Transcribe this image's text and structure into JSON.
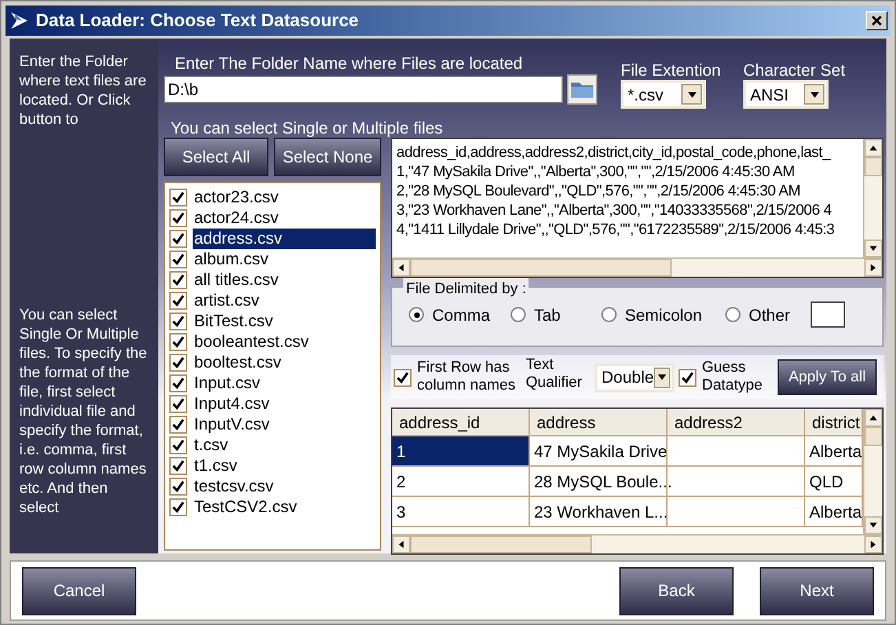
{
  "window": {
    "title": "Data Loader: Choose Text Datasource"
  },
  "sidebar": {
    "top_text": "Enter the Folder where text files are located. Or Click button to",
    "bottom_text": "You can select Single Or Multiple files. To specify the the format of the file, first select individual file and specify the format, i.e. comma, first row column names etc. And then select"
  },
  "folder": {
    "label": "Enter The Folder Name where Files are located",
    "value": "D:\\b"
  },
  "file_extension": {
    "label": "File Extention",
    "value": "*.csv"
  },
  "character_set": {
    "label": "Character Set",
    "value": "ANSI"
  },
  "files_label": "You can select Single or Multiple files",
  "select_buttons": [
    "Select All",
    "Select None"
  ],
  "files": [
    {
      "name": "actor23.csv",
      "checked": true,
      "selected": false
    },
    {
      "name": "actor24.csv",
      "checked": true,
      "selected": false
    },
    {
      "name": "address.csv",
      "checked": true,
      "selected": true
    },
    {
      "name": "album.csv",
      "checked": true,
      "selected": false
    },
    {
      "name": "all titles.csv",
      "checked": true,
      "selected": false
    },
    {
      "name": "artist.csv",
      "checked": true,
      "selected": false
    },
    {
      "name": "BitTest.csv",
      "checked": true,
      "selected": false
    },
    {
      "name": "booleantest.csv",
      "checked": true,
      "selected": false
    },
    {
      "name": "booltest.csv",
      "checked": true,
      "selected": false
    },
    {
      "name": "Input.csv",
      "checked": true,
      "selected": false
    },
    {
      "name": "Input4.csv",
      "checked": true,
      "selected": false
    },
    {
      "name": "InputV.csv",
      "checked": true,
      "selected": false
    },
    {
      "name": "t.csv",
      "checked": true,
      "selected": false
    },
    {
      "name": "t1.csv",
      "checked": true,
      "selected": false
    },
    {
      "name": "testcsv.csv",
      "checked": true,
      "selected": false
    },
    {
      "name": "TestCSV2.csv",
      "checked": true,
      "selected": false
    }
  ],
  "preview_lines": [
    "address_id,address,address2,district,city_id,postal_code,phone,last_",
    "1,\"47 MySakila Drive\",,\"Alberta\",300,\"\",\"\",2/15/2006 4:45:30 AM",
    "2,\"28 MySQL Boulevard\",,\"QLD\",576,\"\",\"\",2/15/2006 4:45:30 AM",
    "3,\"23 Workhaven Lane\",,\"Alberta\",300,\"\",\"14033335568\",2/15/2006 4",
    "4,\"1411 Lillydale Drive\",,\"QLD\",576,\"\",\"6172235589\",2/15/2006 4:45:3"
  ],
  "delimiter": {
    "title": "File Delimited by :",
    "options": [
      {
        "label": "Comma",
        "selected": true
      },
      {
        "label": "Tab",
        "selected": false
      },
      {
        "label": "Semicolon",
        "selected": false
      },
      {
        "label": "Other",
        "selected": false
      }
    ]
  },
  "first_row_header": {
    "label": "First Row has column names",
    "checked": true
  },
  "text_qualifier": {
    "label": "Text Qualifier",
    "value": "Double"
  },
  "guess_datatype": {
    "label": "Guess Datatype",
    "checked": true
  },
  "apply_button": "Apply To all",
  "grid": {
    "columns": [
      "address_id",
      "address",
      "address2",
      "district"
    ],
    "rows": [
      {
        "cells": [
          "1",
          "47 MySakila Drive",
          "",
          "Alberta"
        ],
        "selected": true
      },
      {
        "cells": [
          "2",
          "28 MySQL Boule...",
          "",
          "QLD"
        ],
        "selected": false
      },
      {
        "cells": [
          "3",
          "23 Workhaven L...",
          "",
          "Alberta"
        ],
        "selected": false
      }
    ]
  },
  "footer_buttons": [
    "Cancel",
    "Back",
    "Next"
  ]
}
